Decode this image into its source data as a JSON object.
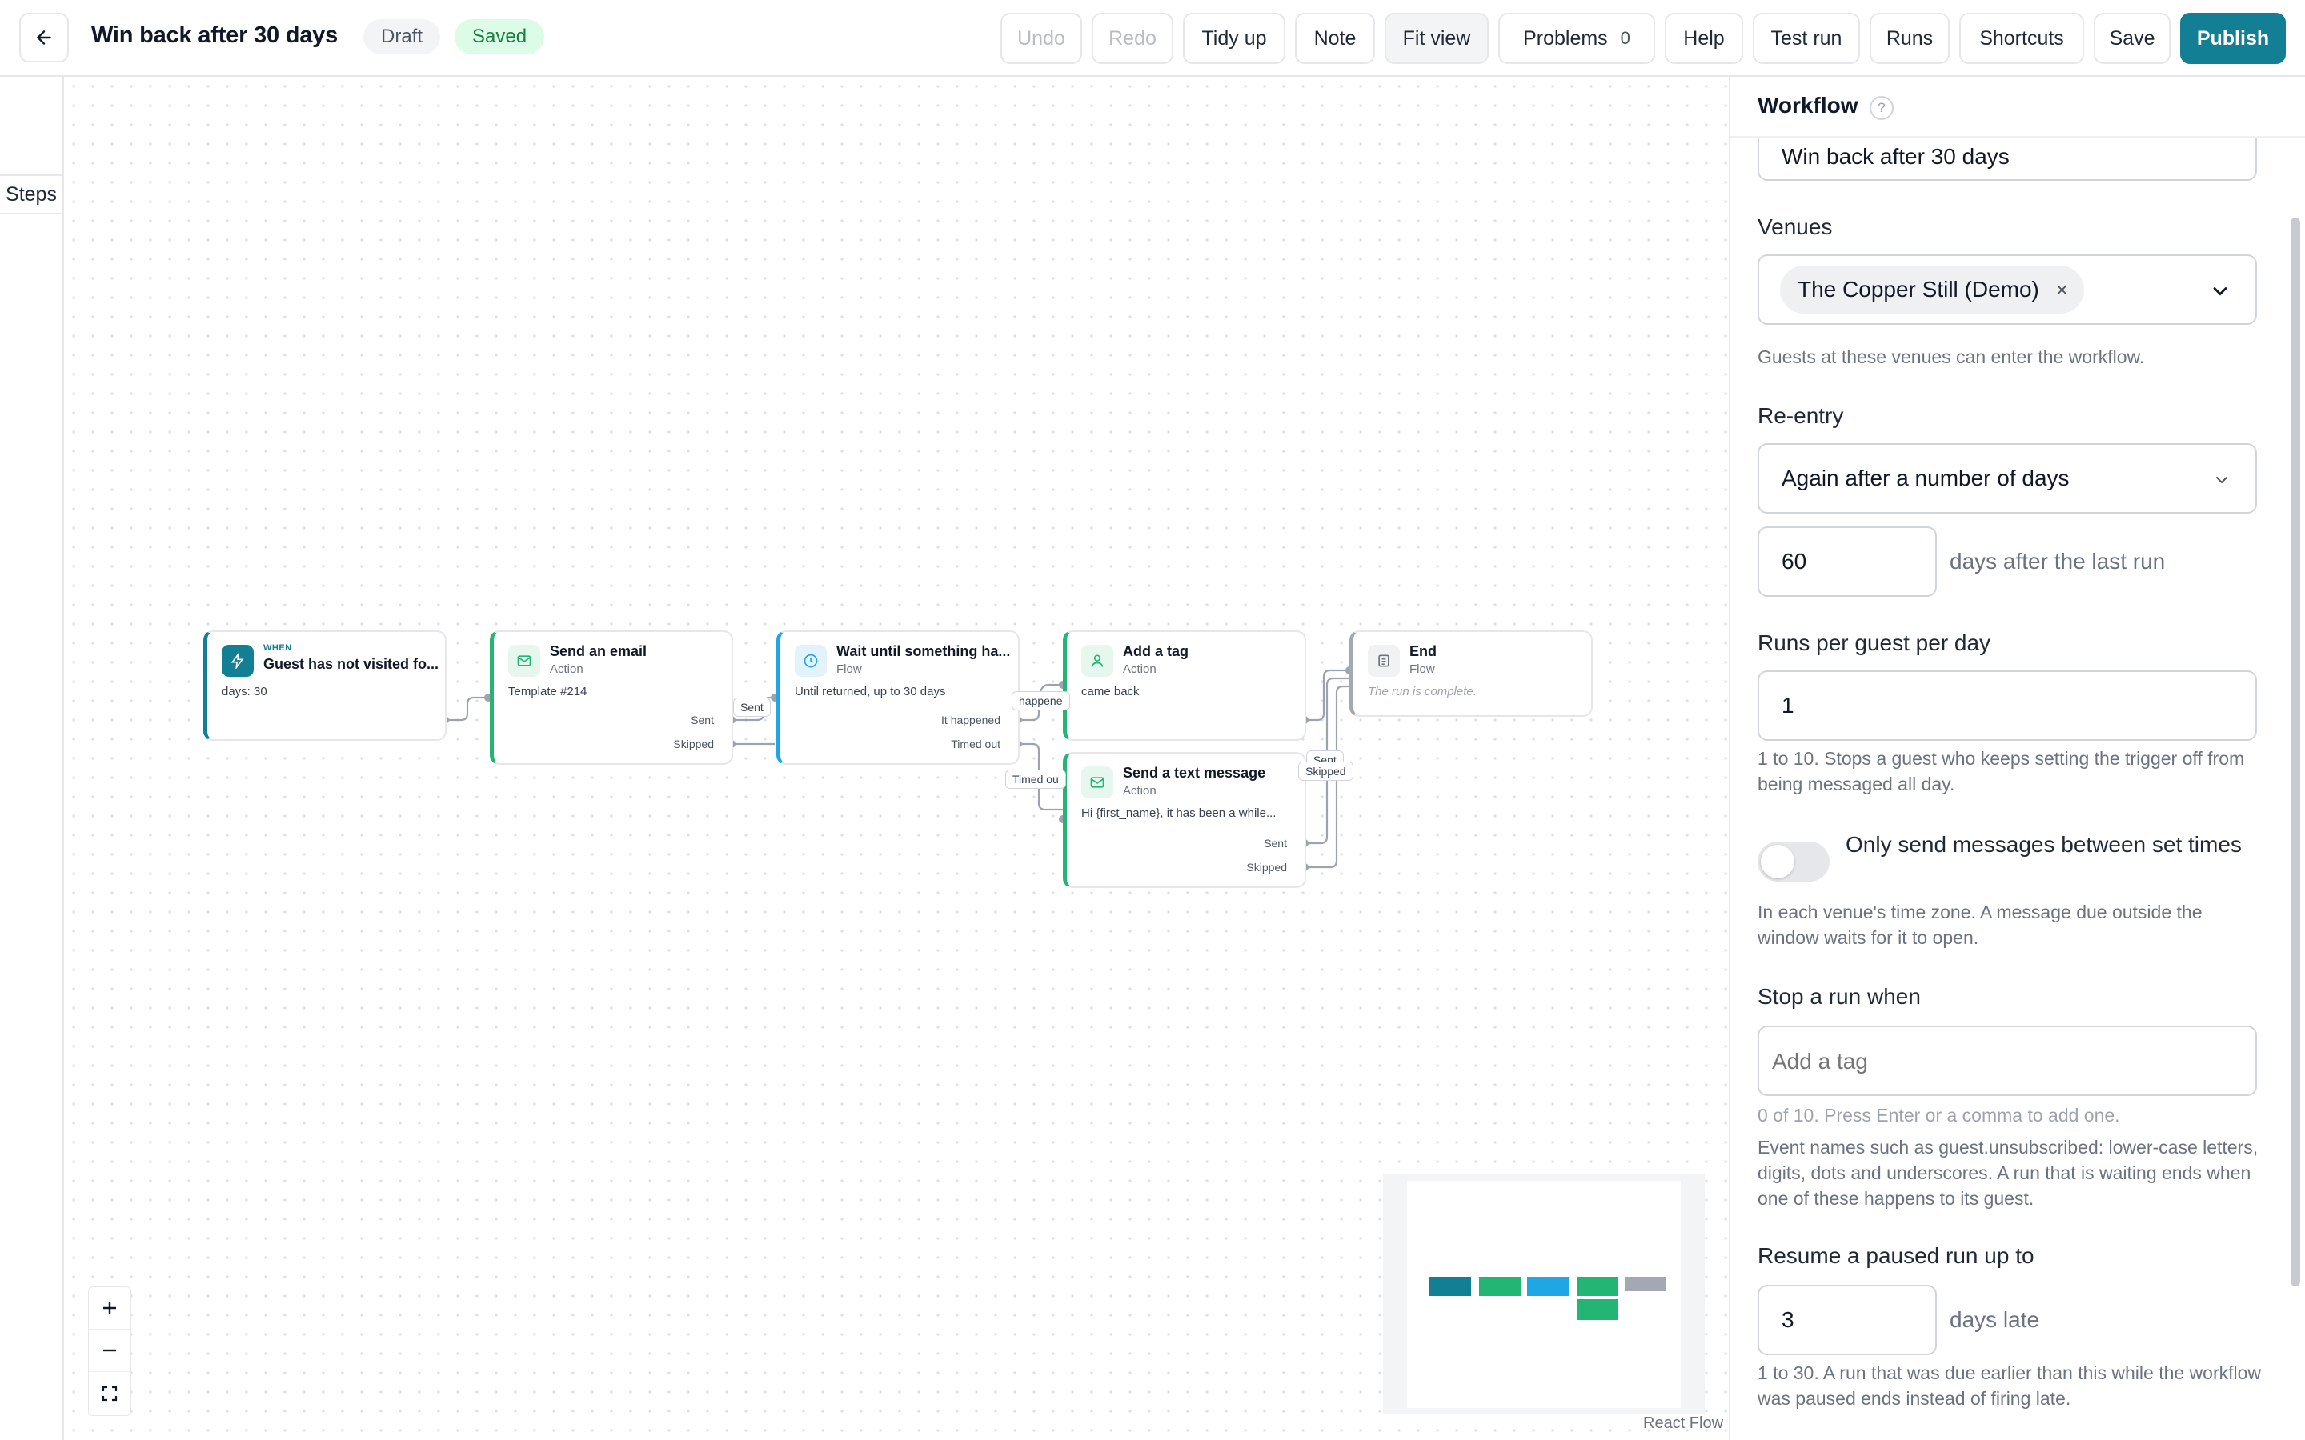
{
  "header": {
    "title": "Win back after 30 days",
    "status_draft": "Draft",
    "status_saved": "Saved",
    "buttons": {
      "undo": "Undo",
      "redo": "Redo",
      "tidy_up": "Tidy up",
      "note": "Note",
      "fit_view": "Fit view",
      "problems": "Problems",
      "problems_count": "0",
      "help": "Help",
      "test_run": "Test run",
      "runs": "Runs",
      "shortcuts": "Shortcuts",
      "save": "Save",
      "publish": "Publish"
    }
  },
  "sidebar": {
    "steps_tab": "Steps"
  },
  "canvas": {
    "nodes": {
      "trigger": {
        "kicker": "WHEN",
        "title": "Guest has not visited fo...",
        "body": "days: 30"
      },
      "email": {
        "title": "Send an email",
        "type": "Action",
        "body": "Template #214",
        "port_sent": "Sent",
        "port_skipped": "Skipped"
      },
      "wait": {
        "title": "Wait until something ha...",
        "type": "Flow",
        "body": "Until returned, up to 30 days",
        "port_happened": "It happened",
        "port_timed_out": "Timed out"
      },
      "tag": {
        "title": "Add a tag",
        "type": "Action",
        "body": "came back"
      },
      "sms": {
        "title": "Send a text message",
        "type": "Action",
        "body": "Hi {first_name}, it has been a while...",
        "port_sent": "Sent",
        "port_skipped": "Skipped"
      },
      "end": {
        "title": "End",
        "type": "Flow",
        "body": "The run is complete."
      }
    },
    "edge_labels": {
      "sent": "Sent",
      "happened": "happene",
      "timed_out": "Timed ou",
      "sent_2": "Sent",
      "skipped": "Skipped"
    },
    "attribution": "React Flow",
    "colors": {
      "trigger": "#137f95",
      "action": "#22b573",
      "flow": "#1ea7e4",
      "end": "#a3a9b3"
    }
  },
  "panel": {
    "title": "Workflow",
    "help_icon": "?",
    "name_value": "Win back after 30 days",
    "venues": {
      "label": "Venues",
      "chip": "The Copper Still (Demo)",
      "chip_remove": "×",
      "help": "Guests at these venues can enter the workflow."
    },
    "reentry": {
      "label": "Re-entry",
      "value": "Again after a number of days",
      "days_value": "60",
      "days_note": "days after the last run"
    },
    "runs_per_day": {
      "label": "Runs per guest per day",
      "value": "1",
      "help": "1 to 10. Stops a guest who keeps setting the trigger off from being messaged all day."
    },
    "set_times": {
      "label": "Only send messages between set times",
      "enabled": false,
      "help": "In each venue's time zone. A message due outside the window waits for it to open."
    },
    "stop_when": {
      "label": "Stop a run when",
      "placeholder": "Add a tag",
      "count_help": "0 of 10. Press Enter or a comma to add one.",
      "help": "Event names such as guest.unsubscribed: lower-case letters, digits, dots and underscores. A run that is waiting ends when one of these happens to its guest."
    },
    "resume": {
      "label": "Resume a paused run up to",
      "value": "3",
      "note": "days late",
      "help": "1 to 30. A run that was due earlier than this while the workflow was paused ends instead of firing late."
    }
  }
}
